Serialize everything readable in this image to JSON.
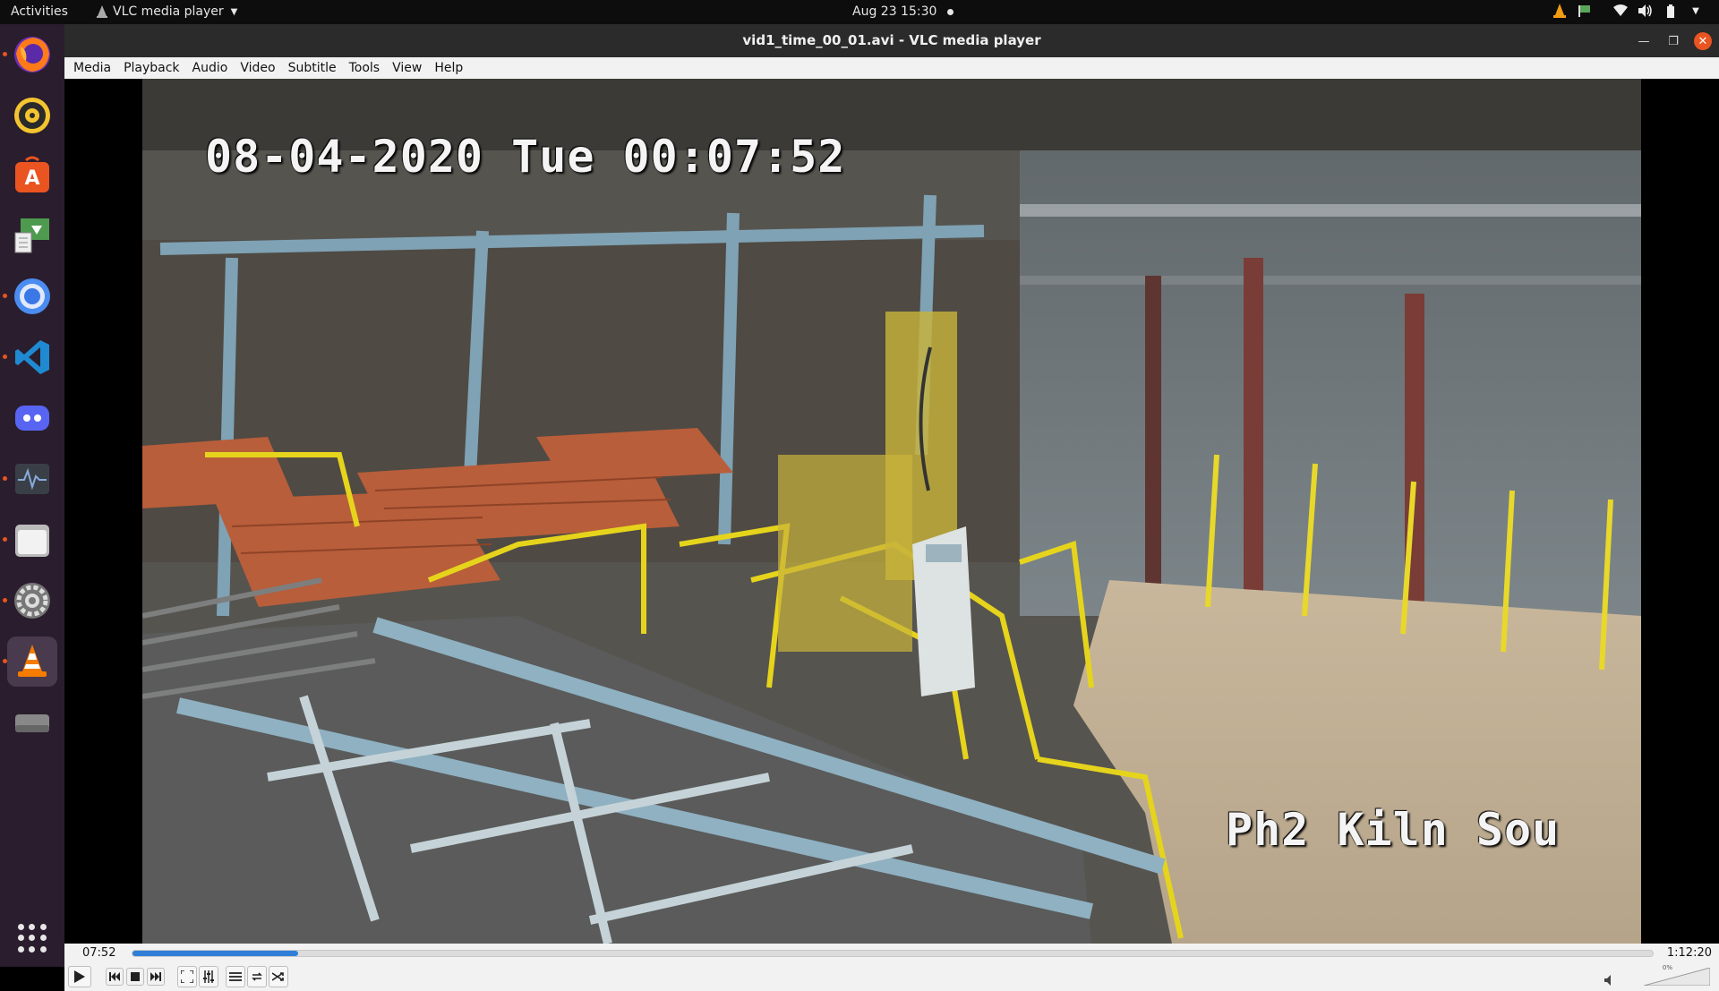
{
  "topbar": {
    "activities": "Activities",
    "app_name": "VLC media player",
    "clock": "Aug 23  15:30",
    "tray_icons": [
      "vlc-tray-icon",
      "flag-icon",
      "wifi-icon",
      "volume-icon",
      "battery-icon",
      "menu-caret-icon"
    ]
  },
  "dock": {
    "items": [
      {
        "name": "firefox",
        "running": true
      },
      {
        "name": "rhythmbox",
        "running": false
      },
      {
        "name": "ubuntu-software",
        "running": false
      },
      {
        "name": "software-updater",
        "running": false
      },
      {
        "name": "chromium",
        "running": true
      },
      {
        "name": "vscode",
        "running": true
      },
      {
        "name": "discord",
        "running": false
      },
      {
        "name": "system-monitor",
        "running": true
      },
      {
        "name": "files",
        "running": true
      },
      {
        "name": "settings",
        "running": true
      },
      {
        "name": "vlc",
        "running": true,
        "active": true
      },
      {
        "name": "disk",
        "running": false
      }
    ],
    "show_apps": "show-applications"
  },
  "window": {
    "title": "vid1_time_00_01.avi - VLC media player"
  },
  "menu": [
    {
      "label": "Media",
      "key": "M"
    },
    {
      "label": "Playback",
      "key": "l"
    },
    {
      "label": "Audio",
      "key": "A"
    },
    {
      "label": "Video",
      "key": "V"
    },
    {
      "label": "Subtitle",
      "key": "t"
    },
    {
      "label": "Tools",
      "key": "s"
    },
    {
      "label": "View",
      "key": "i"
    },
    {
      "label": "Help",
      "key": "H"
    }
  ],
  "video": {
    "osd_timestamp": "08-04-2020 Tue 00:07:52",
    "osd_camera": "Ph2 Kiln Sou"
  },
  "controls": {
    "elapsed": "07:52",
    "total": "1:12:20",
    "progress": 0.109,
    "volume_label": "0%",
    "volume_level": 0.0
  },
  "colors": {
    "accent": "#e95420",
    "seek_fill": "#2f7fd9",
    "dock_bg": "#2a1d2d"
  }
}
